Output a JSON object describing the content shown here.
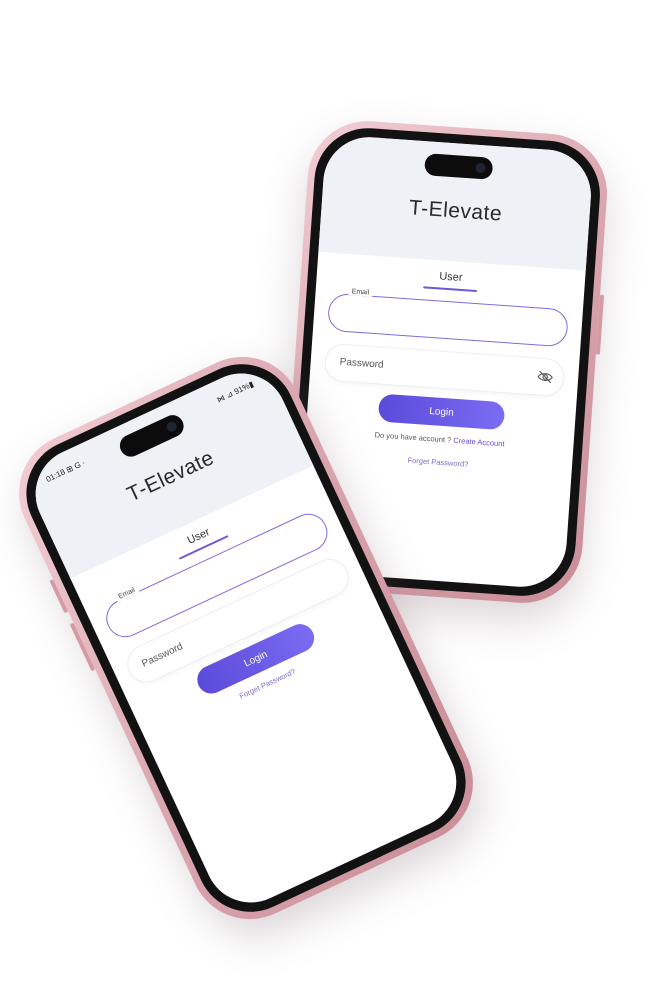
{
  "colors": {
    "accent": "#6a5ad8",
    "button": "#5b4bdb",
    "header_bg": "#eef2f7",
    "phone_frame": "#dba7b0"
  },
  "front_phone": {
    "status_bar": {
      "time": "01:18",
      "indicators": "⊞ G ·",
      "right": "⋈ ⊿ 91%▮"
    },
    "app_title": "T-Elevate",
    "tab": "User",
    "email_label": "Email",
    "password_placeholder": "Password",
    "login_label": "Login",
    "forget_password": "Forget Password?"
  },
  "back_phone": {
    "app_title": "T-Elevate",
    "tab": "User",
    "email_label": "Email",
    "password_placeholder": "Password",
    "login_label": "Login",
    "account_prompt": "Do you have account ?",
    "create_account": "Create Account",
    "forget_password": "Forget Password?",
    "eye_icon": "eye-off-icon"
  }
}
